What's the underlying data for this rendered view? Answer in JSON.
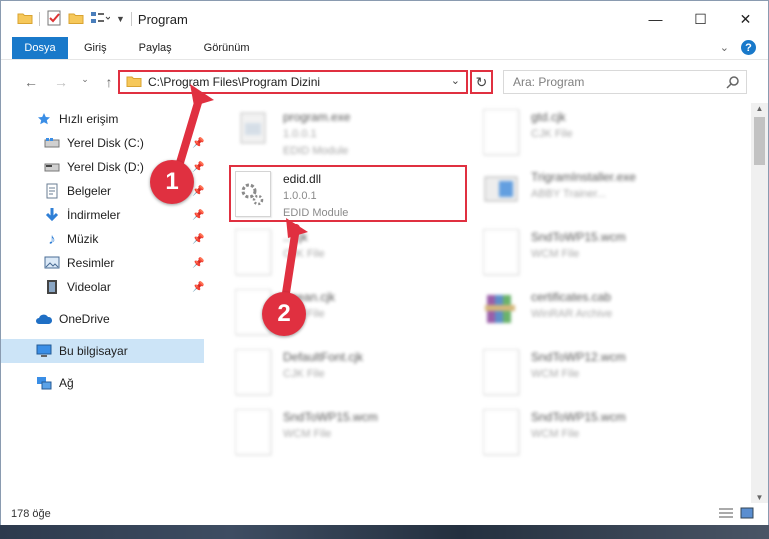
{
  "window": {
    "title": "Program"
  },
  "ribbon": {
    "file_tab": "Dosya",
    "tabs": [
      "Giriş",
      "Paylaş",
      "Görünüm"
    ]
  },
  "address": {
    "path": "C:\\Program Files\\Program Dizini",
    "search_placeholder": "Ara: Program"
  },
  "sidebar": {
    "quick_access": "Hızlı erişim",
    "items": [
      {
        "label": "Yerel Disk (C:)",
        "icon": "drive-icon"
      },
      {
        "label": "Yerel Disk (D:)",
        "icon": "drive-icon"
      },
      {
        "label": "Belgeler",
        "icon": "documents-icon"
      },
      {
        "label": "İndirmeler",
        "icon": "download-icon"
      },
      {
        "label": "Müzik",
        "icon": "music-icon"
      },
      {
        "label": "Resimler",
        "icon": "pictures-icon"
      },
      {
        "label": "Videolar",
        "icon": "video-icon"
      }
    ],
    "onedrive": "OneDrive",
    "this_pc": "Bu bilgisayar",
    "network": "Ağ"
  },
  "files": {
    "left": [
      {
        "name": "program.exe",
        "line2": "1.0.0.1",
        "line3": "EDID Module"
      },
      {
        "name": "edid.dll",
        "line2": "1.0.0.1",
        "line3": "EDID Module"
      },
      {
        "name": "...cjk",
        "line2": "CJK File"
      },
      {
        "name": "...rean.cjk",
        "line2": "CJK File"
      },
      {
        "name": "DefaultFont.cjk",
        "line2": "CJK File"
      },
      {
        "name": "SndToWP15.wcm",
        "line2": "WCM File"
      }
    ],
    "right": [
      {
        "name": "gtd.cjk",
        "line2": "CJK File"
      },
      {
        "name": "TrigramInstaller.exe",
        "line2": "ABBY Trainer..."
      },
      {
        "name": "SndToWP15.wcm",
        "line2": "WCM File"
      },
      {
        "name": "certificates.cab",
        "line2": "WinRAR Archive"
      },
      {
        "name": "SndToWP12.wcm",
        "line2": "WCM File"
      },
      {
        "name": "SndToWP15.wcm",
        "line2": "WCM File"
      }
    ]
  },
  "annotations": {
    "step1": "1",
    "step2": "2"
  },
  "status": {
    "count": "178 öğe"
  },
  "colors": {
    "accent": "#1979ca",
    "highlight": "#e03040"
  }
}
